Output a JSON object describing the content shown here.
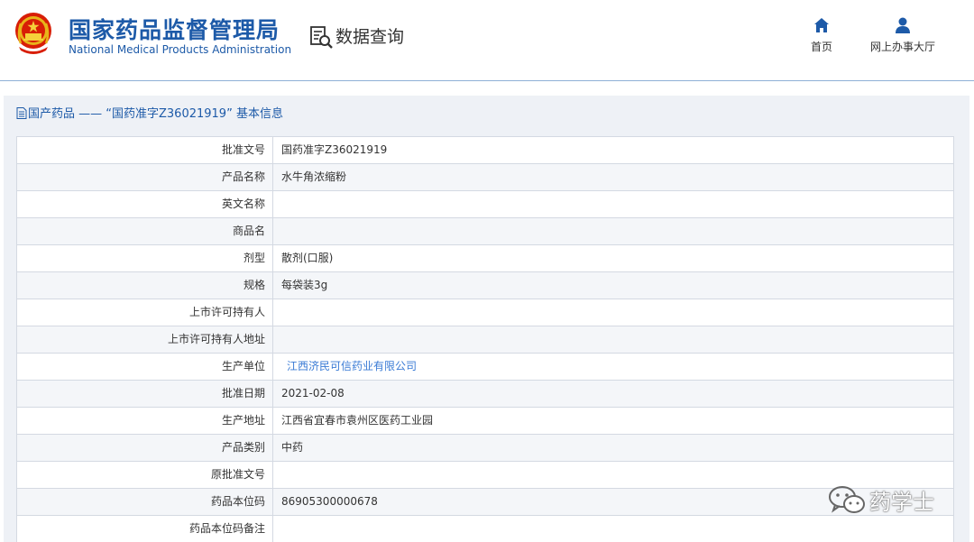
{
  "header": {
    "logo_cn": "国家药品监督管理局",
    "logo_en": "National Medical Products Administration",
    "query_title": "数据查询",
    "nav": [
      {
        "label": "首页",
        "icon": "home-icon"
      },
      {
        "label": "网上办事大厅",
        "icon": "user-icon"
      }
    ],
    "colors": {
      "brand": "#1d5aa8",
      "link": "#3a7bd5"
    }
  },
  "panel": {
    "title": "国产药品 —— “国药准字Z36021919” 基本信息"
  },
  "table": {
    "rows": [
      {
        "label": "批准文号",
        "value": "国药准字Z36021919"
      },
      {
        "label": "产品名称",
        "value": "水牛角浓缩粉"
      },
      {
        "label": "英文名称",
        "value": ""
      },
      {
        "label": "商品名",
        "value": ""
      },
      {
        "label": "剂型",
        "value": "散剂(口服)"
      },
      {
        "label": "规格",
        "value": "每袋装3g"
      },
      {
        "label": "上市许可持有人",
        "value": ""
      },
      {
        "label": "上市许可持有人地址",
        "value": ""
      },
      {
        "label": "生产单位",
        "value": "江西济民可信药业有限公司"
      },
      {
        "label": "批准日期",
        "value": "2021-02-08"
      },
      {
        "label": "生产地址",
        "value": "江西省宜春市袁州区医药工业园"
      },
      {
        "label": "产品类别",
        "value": "中药"
      },
      {
        "label": "原批准文号",
        "value": ""
      },
      {
        "label": "药品本位码",
        "value": "86905300000678"
      },
      {
        "label": "药品本位码备注",
        "value": ""
      }
    ]
  },
  "watermark": {
    "text": "药学士"
  }
}
